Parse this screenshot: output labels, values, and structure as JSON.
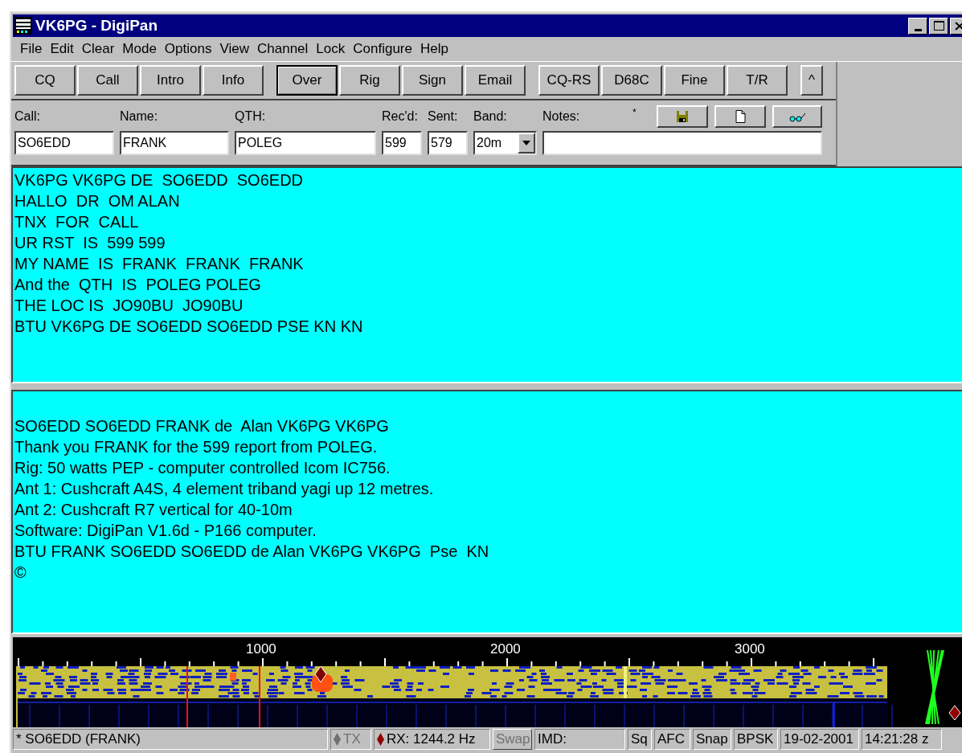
{
  "window": {
    "title": "VK6PG - DigiPan"
  },
  "menu": [
    "File",
    "Edit",
    "Clear",
    "Mode",
    "Options",
    "View",
    "Channel",
    "Lock",
    "Configure",
    "Help"
  ],
  "toolbar": {
    "groups": [
      [
        {
          "label": "CQ",
          "selected": false
        },
        {
          "label": "Call",
          "selected": false
        },
        {
          "label": "Intro",
          "selected": false
        },
        {
          "label": "Info",
          "selected": false
        }
      ],
      [
        {
          "label": "Over",
          "selected": true
        },
        {
          "label": "Rig",
          "selected": false
        },
        {
          "label": "Sign",
          "selected": false
        },
        {
          "label": "Email",
          "selected": false
        }
      ],
      [
        {
          "label": "CQ-RS",
          "selected": false
        },
        {
          "label": "D68C",
          "selected": false
        },
        {
          "label": "Fine",
          "selected": false
        },
        {
          "label": "T/R",
          "selected": false
        }
      ],
      [
        {
          "label": "^",
          "selected": false
        }
      ]
    ]
  },
  "log": {
    "fields": [
      {
        "label": "Call:",
        "value": "SO6EDD",
        "kind": "text"
      },
      {
        "label": "Name:",
        "value": "FRANK",
        "kind": "text"
      },
      {
        "label": "QTH:",
        "value": "POLEG",
        "kind": "text"
      },
      {
        "label": "Rec'd:",
        "value": "599",
        "kind": "text"
      },
      {
        "label": "Sent:",
        "value": "579",
        "kind": "text"
      },
      {
        "label": "Band:",
        "value": "20m",
        "kind": "select"
      },
      {
        "label": "Notes:",
        "kind": "notes"
      }
    ],
    "modified_mark": "*"
  },
  "receive_text": [
    "VK6PG VK6PG DE  SO6EDD  SO6EDD",
    "HALLO  DR  OM ALAN",
    "TNX  FOR  CALL",
    "UR RST  IS  599 599",
    "MY NAME  IS  FRANK  FRANK  FRANK",
    "And the  QTH  IS  POLEG POLEG",
    "THE LOC IS  JO90BU  JO90BU",
    "BTU VK6PG DE SO6EDD SO6EDD PSE KN KN"
  ],
  "transmit_text": [
    "SO6EDD SO6EDD FRANK de  Alan VK6PG VK6PG",
    "Thank you FRANK for the 599 report from POLEG.",
    "Rig: 50 watts PEP - computer controlled Icom IC756.",
    "Ant 1: Cushcraft A4S, 4 element triband yagi up 12 metres.",
    "Ant 2: Cushcraft R7 vertical for 40-10m",
    "Software: DigiPan V1.6d - P166 computer.",
    "BTU FRANK SO6EDD SO6EDD de Alan VK6PG VK6PG  Pse  KN",
    "©"
  ],
  "waterfall": {
    "scale_labels": [
      "1000",
      "2000",
      "3000"
    ]
  },
  "status_bar": [
    {
      "text": "* SO6EDD (FRANK)",
      "disabled": false,
      "kind": "text"
    },
    {
      "text": "TX",
      "disabled": true,
      "kind": "diamond"
    },
    {
      "text": "RX: 1244.2 Hz",
      "disabled": false,
      "kind": "diamond"
    },
    {
      "text": "Swap",
      "disabled": true,
      "kind": "button"
    },
    {
      "text": "IMD:",
      "disabled": false,
      "kind": "text"
    },
    {
      "text": "Sq",
      "disabled": false,
      "kind": "text"
    },
    {
      "text": "AFC",
      "disabled": false,
      "kind": "text"
    },
    {
      "text": "Snap",
      "disabled": false,
      "kind": "text"
    },
    {
      "text": "BPSK",
      "disabled": false,
      "kind": "text"
    },
    {
      "text": "19-02-2001",
      "disabled": false,
      "kind": "text"
    },
    {
      "text": "14:21:28 z",
      "disabled": false,
      "kind": "text"
    }
  ]
}
